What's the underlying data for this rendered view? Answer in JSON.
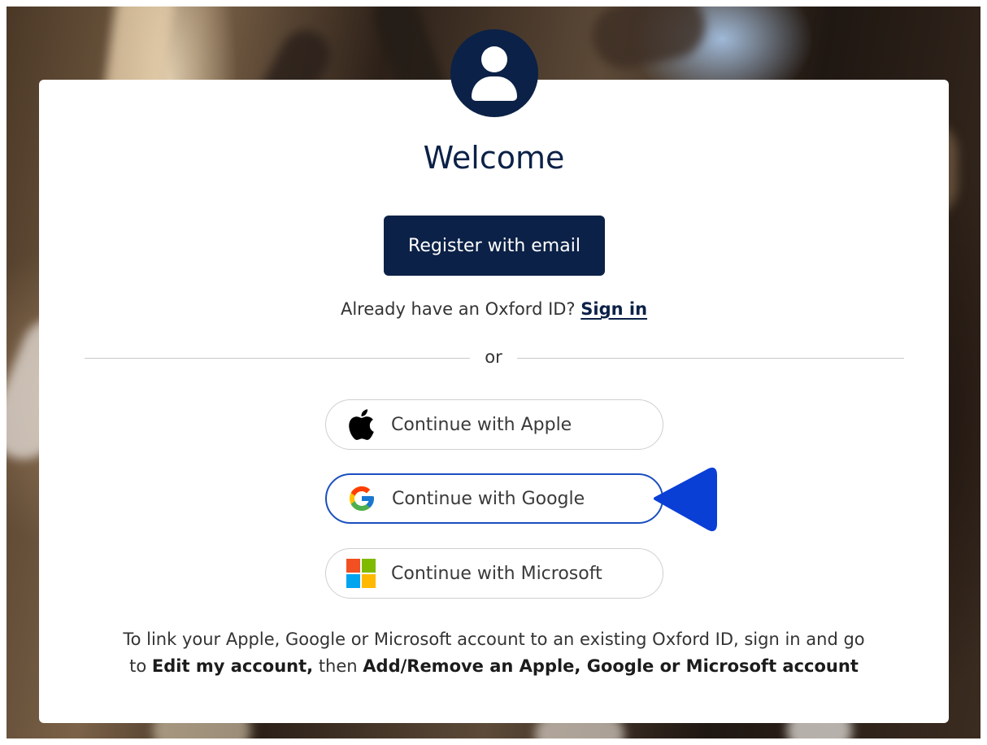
{
  "page": {
    "title": "Welcome",
    "register_button": "Register with email",
    "signin_prompt": "Already have an Oxford ID?",
    "signin_link": "Sign in",
    "divider_text": "or"
  },
  "social_buttons": [
    {
      "label": "Continue with Apple",
      "icon": "apple-icon"
    },
    {
      "label": "Continue with Google",
      "icon": "google-icon",
      "highlighted": true
    },
    {
      "label": "Continue with Microsoft",
      "icon": "microsoft-icon"
    }
  ],
  "footer": {
    "line1": "To link your Apple, Google or Microsoft account to an existing Oxford ID, sign in and go",
    "line2_prefix": "to",
    "line2_bold1": "Edit my account,",
    "line2_mid": "then",
    "line2_bold2": "Add/Remove an Apple, Google or Microsoft account"
  },
  "colors": {
    "brand_navy": "#0b2147",
    "highlight_blue": "#1a4fbf",
    "pointer_blue": "#0a3fd6"
  }
}
